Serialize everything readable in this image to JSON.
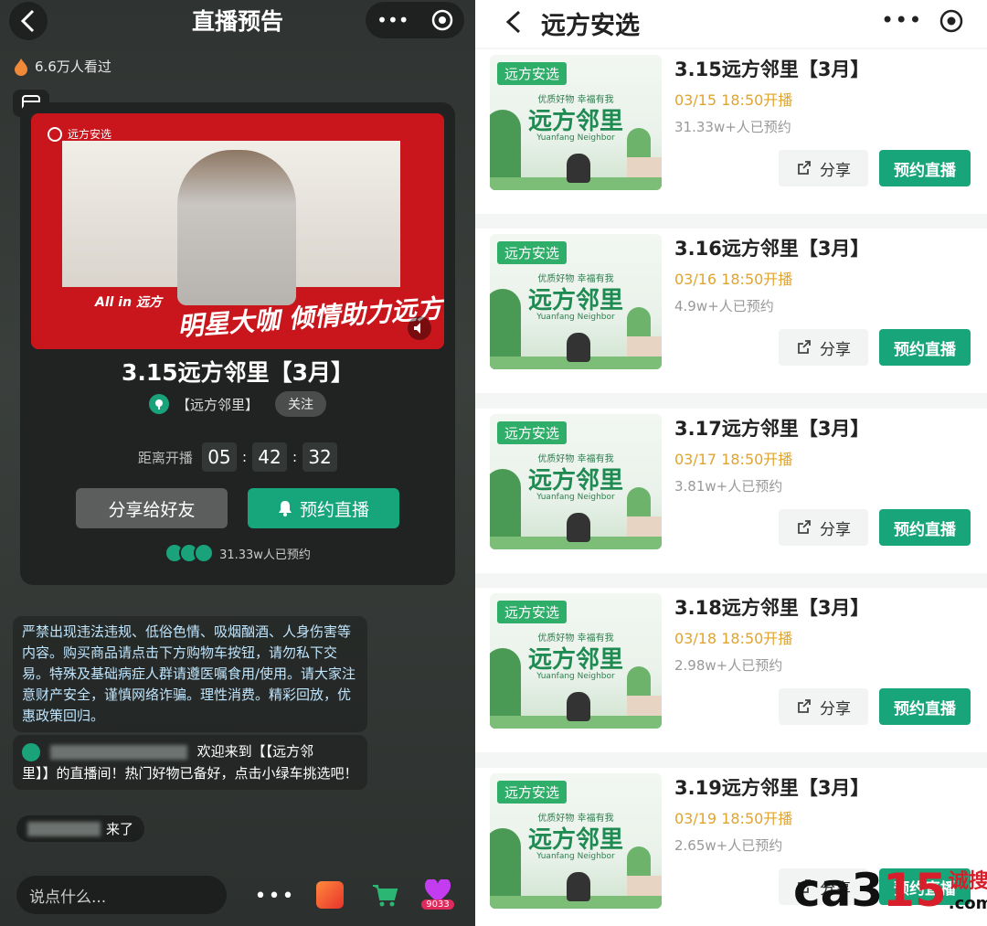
{
  "left": {
    "title": "直播预告",
    "views": "6.6万人看过",
    "banner": {
      "brand": "远方安选",
      "allin": "All in 远方",
      "slogan": "明星大咖 倾情助力远方安选"
    },
    "card_title": "3.15远方邻里【3月】",
    "host": "【远方邻里】",
    "follow": "关注",
    "countdown_label": "距离开播",
    "countdown": {
      "h": "05",
      "m": "42",
      "s": "32"
    },
    "share_btn": "分享给好友",
    "reserve_btn": "预约直播",
    "reserved": "31.33w人已预约",
    "notice": "严禁出现违法违规、低俗色情、吸烟酗酒、人身伤害等内容。购买商品请点击下方购物车按钮，请勿私下交易。特殊及基础病症人群请遵医嘱食用/使用。请大家注意财产安全，谨慎网络诈骗。理性消费。精彩回放，优惠政策回归。",
    "welcome_a": "欢迎来到【【远方邻",
    "welcome_b": "里】】的直播间！热门好物已备好，点击小绿车挑选吧！",
    "came": "来了",
    "say_placeholder": "说点什么...",
    "more": "•••",
    "like_count": "9033"
  },
  "right": {
    "title": "远方安选",
    "thumb": {
      "tag": "远方安选",
      "small": "优质好物  幸福有我",
      "big": "远方邻里",
      "sub": "Yuanfang Neighbor"
    },
    "share_label": "分享",
    "reserve_label": "预约直播",
    "items": [
      {
        "title": "3.15远方邻里【3月】",
        "time": "03/15 18:50开播",
        "count": "31.33w+人已预约"
      },
      {
        "title": "3.16远方邻里【3月】",
        "time": "03/16 18:50开播",
        "count": "4.9w+人已预约"
      },
      {
        "title": "3.17远方邻里【3月】",
        "time": "03/17 18:50开播",
        "count": "3.81w+人已预约"
      },
      {
        "title": "3.18远方邻里【3月】",
        "time": "03/18 18:50开播",
        "count": "2.98w+人已预约"
      },
      {
        "title": "3.19远方邻里【3月】",
        "time": "03/19 18:50开播",
        "count": "2.65w+人已预约"
      }
    ]
  },
  "watermark": {
    "main_a": "ca3",
    "main_b": "15",
    "cn": "诚搜",
    "com": ".com"
  },
  "colors": {
    "accent_green": "#17a57c",
    "time_orange": "#e0a42e",
    "banner_red": "#c8161c"
  }
}
